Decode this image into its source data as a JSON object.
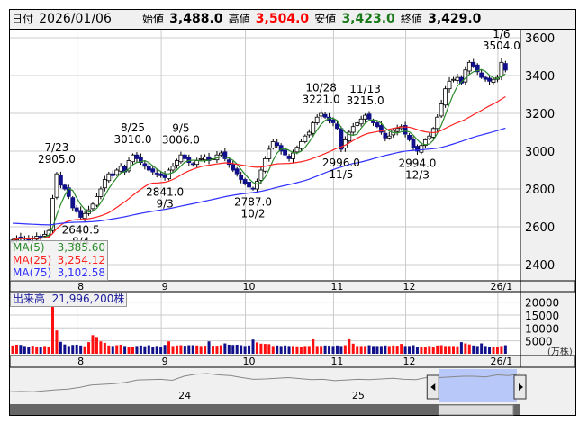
{
  "header": {
    "date_label": "日付",
    "date": "2026/01/06",
    "open_label": "始値",
    "open": "3,488.0",
    "high_label": "高値",
    "high": "3,504.0",
    "low_label": "安値",
    "low": "3,423.0",
    "close_label": "終値",
    "close": "3,429.0"
  },
  "ma_legend": [
    {
      "name": "MA(5)",
      "value": "3,385.60",
      "color": "#2a8a2a"
    },
    {
      "name": "MA(25)",
      "value": "3,254.12",
      "color": "#ff2020"
    },
    {
      "name": "MA(75)",
      "value": "3,102.58",
      "color": "#3030ff"
    }
  ],
  "volume_legend": {
    "label": "出来高",
    "value": "21,996,200株"
  },
  "volume_unit": "(万株)",
  "colors": {
    "up_volume": "#ff1010",
    "down_volume": "#10108a",
    "down_candle": "#10108a",
    "ma5": "#2a8a2a",
    "ma25": "#ff2020",
    "ma75": "#3030ff"
  },
  "chart_data": {
    "type": "candlestick",
    "price_axis": {
      "ticks": [
        2400,
        2600,
        2800,
        3000,
        3200,
        3400,
        3600
      ],
      "range": [
        2360,
        3640
      ]
    },
    "month_labels": [
      {
        "label": "8",
        "i": 17
      },
      {
        "label": "9",
        "i": 38
      },
      {
        "label": "10",
        "i": 59
      },
      {
        "label": "11",
        "i": 81
      },
      {
        "label": "12",
        "i": 99
      },
      {
        "label": "26/1",
        "i": 122
      }
    ],
    "closes": [
      2530,
      2540,
      2545,
      2535,
      2530,
      2540,
      2550,
      2545,
      2560,
      2580,
      2750,
      2880,
      2820,
      2800,
      2760,
      2700,
      2680,
      2650,
      2670,
      2690,
      2720,
      2760,
      2800,
      2850,
      2880,
      2870,
      2900,
      2920,
      2890,
      2950,
      2980,
      2960,
      2940,
      2920,
      2900,
      2890,
      2880,
      2870,
      2860,
      2900,
      2920,
      2950,
      2980,
      2960,
      2940,
      2930,
      2950,
      2960,
      2970,
      2950,
      2960,
      2980,
      2990,
      2960,
      2930,
      2900,
      2880,
      2850,
      2830,
      2810,
      2800,
      2840,
      2900,
      2960,
      3010,
      3050,
      3030,
      3000,
      2980,
      2960,
      2990,
      3020,
      3050,
      3080,
      3100,
      3150,
      3180,
      3200,
      3180,
      3160,
      3150,
      3120,
      3010,
      3060,
      3100,
      3130,
      3150,
      3170,
      3190,
      3170,
      3150,
      3130,
      3100,
      3070,
      3080,
      3110,
      3120,
      3130,
      3090,
      3060,
      3020,
      3000,
      3030,
      3060,
      3080,
      3120,
      3180,
      3250,
      3330,
      3370,
      3380,
      3390,
      3360,
      3430,
      3470,
      3450,
      3420,
      3390,
      3380,
      3370,
      3380,
      3390,
      3470,
      3429
    ],
    "annotations": [
      {
        "i": 11,
        "date": "7/23",
        "value": "2905.0",
        "pos": "above",
        "price": 2905
      },
      {
        "i": 17,
        "date": "8/4",
        "value": "2640.5",
        "pos": "below",
        "price": 2640.5
      },
      {
        "i": 30,
        "date": "8/25",
        "value": "3010.0",
        "pos": "above",
        "price": 3010
      },
      {
        "i": 38,
        "date": "9/3",
        "value": "2841.0",
        "pos": "below",
        "price": 2841
      },
      {
        "i": 42,
        "date": "9/5",
        "value": "3006.0",
        "pos": "above",
        "price": 3006
      },
      {
        "i": 60,
        "date": "10/2",
        "value": "2787.0",
        "pos": "below",
        "price": 2787
      },
      {
        "i": 77,
        "date": "10/28",
        "value": "3221.0",
        "pos": "above",
        "price": 3221
      },
      {
        "i": 82,
        "date": "11/5",
        "value": "2996.0",
        "pos": "below",
        "price": 2996
      },
      {
        "i": 88,
        "date": "11/13",
        "value": "3215.0",
        "pos": "above",
        "price": 3215
      },
      {
        "i": 101,
        "date": "12/3",
        "value": "2994.0",
        "pos": "below",
        "price": 2994
      },
      {
        "i": 122,
        "date": "1/6",
        "value": "3504.0",
        "pos": "above",
        "price": 3504
      }
    ],
    "volume_axis": {
      "ticks": [
        5000,
        10000,
        15000,
        20000
      ],
      "unit": "万株"
    },
    "volumes": [
      3200,
      3500,
      3400,
      3000,
      2600,
      3100,
      2800,
      2600,
      3000,
      2800,
      20000,
      9000,
      4600,
      3600,
      3000,
      3400,
      3500,
      3200,
      2900,
      4500,
      7200,
      6500,
      4800,
      4200,
      3200,
      3000,
      3300,
      3500,
      3000,
      2700,
      2600,
      3000,
      3200,
      2900,
      3300,
      2700,
      3000,
      2800,
      3400,
      4800,
      3000,
      3200,
      3300,
      3100,
      3300,
      3300,
      3200,
      3000,
      3100,
      4800,
      3100,
      3100,
      3300,
      4000,
      3500,
      3400,
      3500,
      3300,
      3000,
      3200,
      5500,
      4400,
      3900,
      3800,
      3700,
      3000,
      3200,
      3000,
      3200,
      3000,
      3000,
      2900,
      2800,
      3000,
      3000,
      5600,
      3000,
      3000,
      3200,
      3100,
      3000,
      3200,
      3000,
      3300,
      5600,
      3900,
      3000,
      3000,
      3000,
      3300,
      3000,
      3000,
      3000,
      3200,
      3000,
      3200,
      3100,
      3800,
      3000,
      3000,
      3300,
      2600,
      2800,
      2700,
      3000,
      2800,
      3200,
      3300,
      3000,
      3000,
      3000,
      2900,
      4500,
      4000,
      3600,
      3200,
      3000,
      4000,
      3000,
      2800,
      2700,
      2600,
      3000,
      3300
    ],
    "navigator": {
      "labels": [
        {
          "label": "24",
          "at": 0.33
        },
        {
          "label": "25",
          "at": 0.67
        }
      ],
      "series": [
        2100,
        2110,
        2100,
        2130,
        2160,
        2180,
        2230,
        2300,
        2320,
        2340,
        2380,
        2450,
        2460,
        2470,
        2440,
        2560,
        2620,
        2640,
        2600,
        2580,
        2520,
        2470,
        2480,
        2500,
        2520,
        2490,
        2460,
        2470,
        2430,
        2450,
        2470,
        2460,
        2480,
        2500,
        2470,
        2460,
        2530,
        2520,
        2540,
        2560,
        2560,
        2540,
        2600,
        2580,
        2640
      ],
      "selection_start": 0.84
    }
  }
}
